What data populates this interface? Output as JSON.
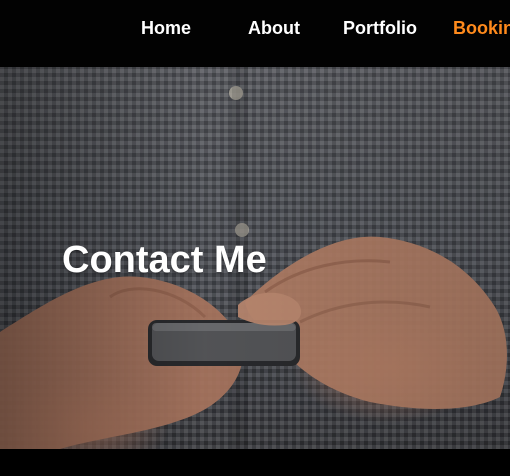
{
  "theme": {
    "accent": "#ff8a1c",
    "nav_bg": "#020202",
    "text": "#ffffff"
  },
  "nav": {
    "items": [
      {
        "label": "Home"
      },
      {
        "label": "About"
      },
      {
        "label": "Portfolio"
      },
      {
        "label": "Booking"
      }
    ],
    "active_index": 3
  },
  "hero": {
    "title": "Contact Me",
    "image": "person-holding-smartphone-photo"
  }
}
